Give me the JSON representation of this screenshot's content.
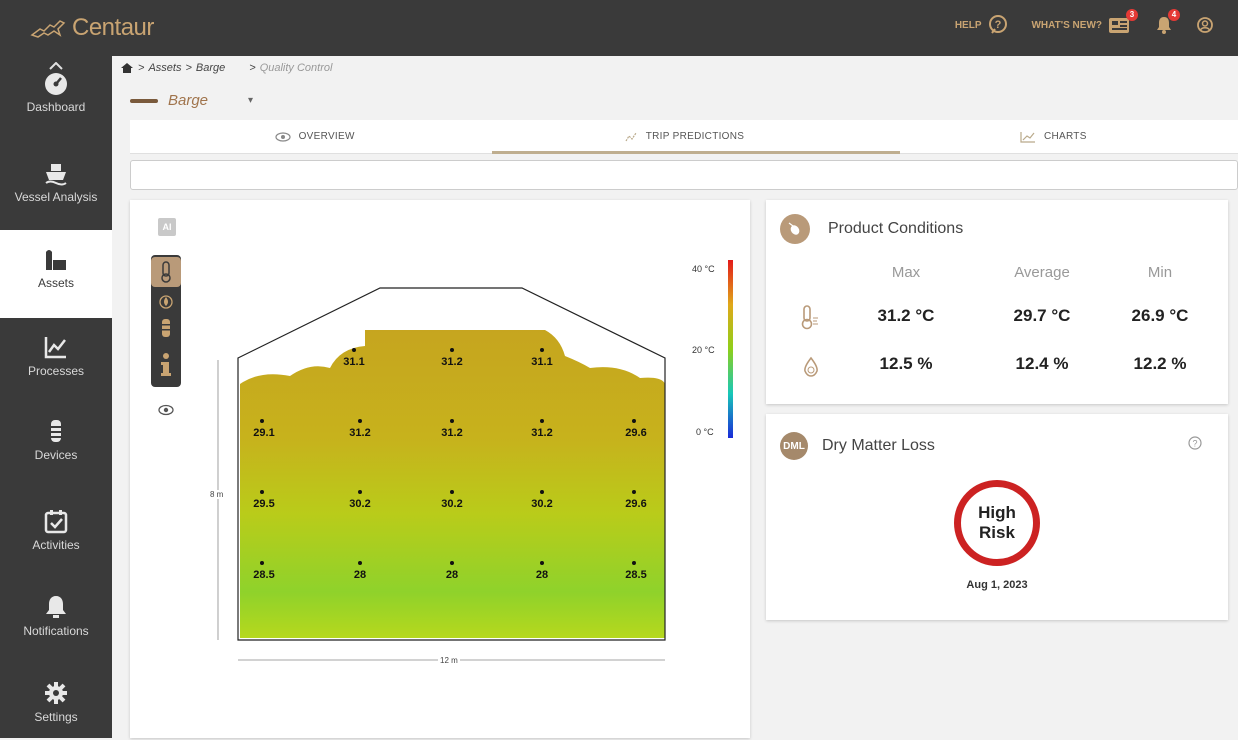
{
  "app": {
    "name": "Centaur"
  },
  "topbar": {
    "help_label": "HELP",
    "whats_new_label": "WHAT'S NEW?",
    "whats_new_badge": "3",
    "notifications_badge": "4"
  },
  "sidebar": {
    "items": [
      {
        "label": "Dashboard",
        "icon": "gauge-icon"
      },
      {
        "label": "Vessel Analysis",
        "icon": "ship-icon"
      },
      {
        "label": "Assets",
        "icon": "silo-icon"
      },
      {
        "label": "Processes",
        "icon": "chart-icon"
      },
      {
        "label": "Devices",
        "icon": "sensor-icon"
      },
      {
        "label": "Activities",
        "icon": "calendar-check-icon"
      },
      {
        "label": "Notifications",
        "icon": "bell-icon"
      },
      {
        "label": "Settings",
        "icon": "gear-icon"
      }
    ],
    "active_index": 2
  },
  "breadcrumb": {
    "assets": "Assets",
    "barge": "Barge",
    "current": "Quality Control"
  },
  "asset_selector": {
    "value": "Barge"
  },
  "tabs": [
    {
      "label": "OVERVIEW",
      "icon": "eye-icon"
    },
    {
      "label": "TRIP PREDICTIONS",
      "icon": "sparkle-icon"
    },
    {
      "label": "CHARTS",
      "icon": "line-chart-icon"
    }
  ],
  "active_tab": 1,
  "heatmap": {
    "ai_label": "AI",
    "width_label": "12 m",
    "height_label": "8 m",
    "legend": {
      "max": "40 °C",
      "mid": "20 °C",
      "min": "0 °C"
    },
    "rows": [
      [
        "31.1",
        "31.2",
        "31.1"
      ],
      [
        "29.1",
        "31.2",
        "31.2",
        "31.2",
        "29.6"
      ],
      [
        "29.5",
        "30.2",
        "30.2",
        "30.2",
        "29.6"
      ],
      [
        "28.5",
        "28",
        "28",
        "28",
        "28.5"
      ]
    ]
  },
  "product_conditions": {
    "title": "Product Conditions",
    "headers": [
      "Max",
      "Average",
      "Min"
    ],
    "temperature": [
      "31.2 °C",
      "29.7 °C",
      "26.9 °C"
    ],
    "moisture": [
      "12.5 %",
      "12.4 %",
      "12.2 %"
    ]
  },
  "dry_matter_loss": {
    "badge": "DML",
    "title": "Dry Matter Loss",
    "risk_line1": "High",
    "risk_line2": "Risk",
    "date": "Aug 1, 2023"
  },
  "colors": {
    "risk": "#cc2222",
    "accent": "#c9a472",
    "sidebar": "#3a3a3a"
  }
}
